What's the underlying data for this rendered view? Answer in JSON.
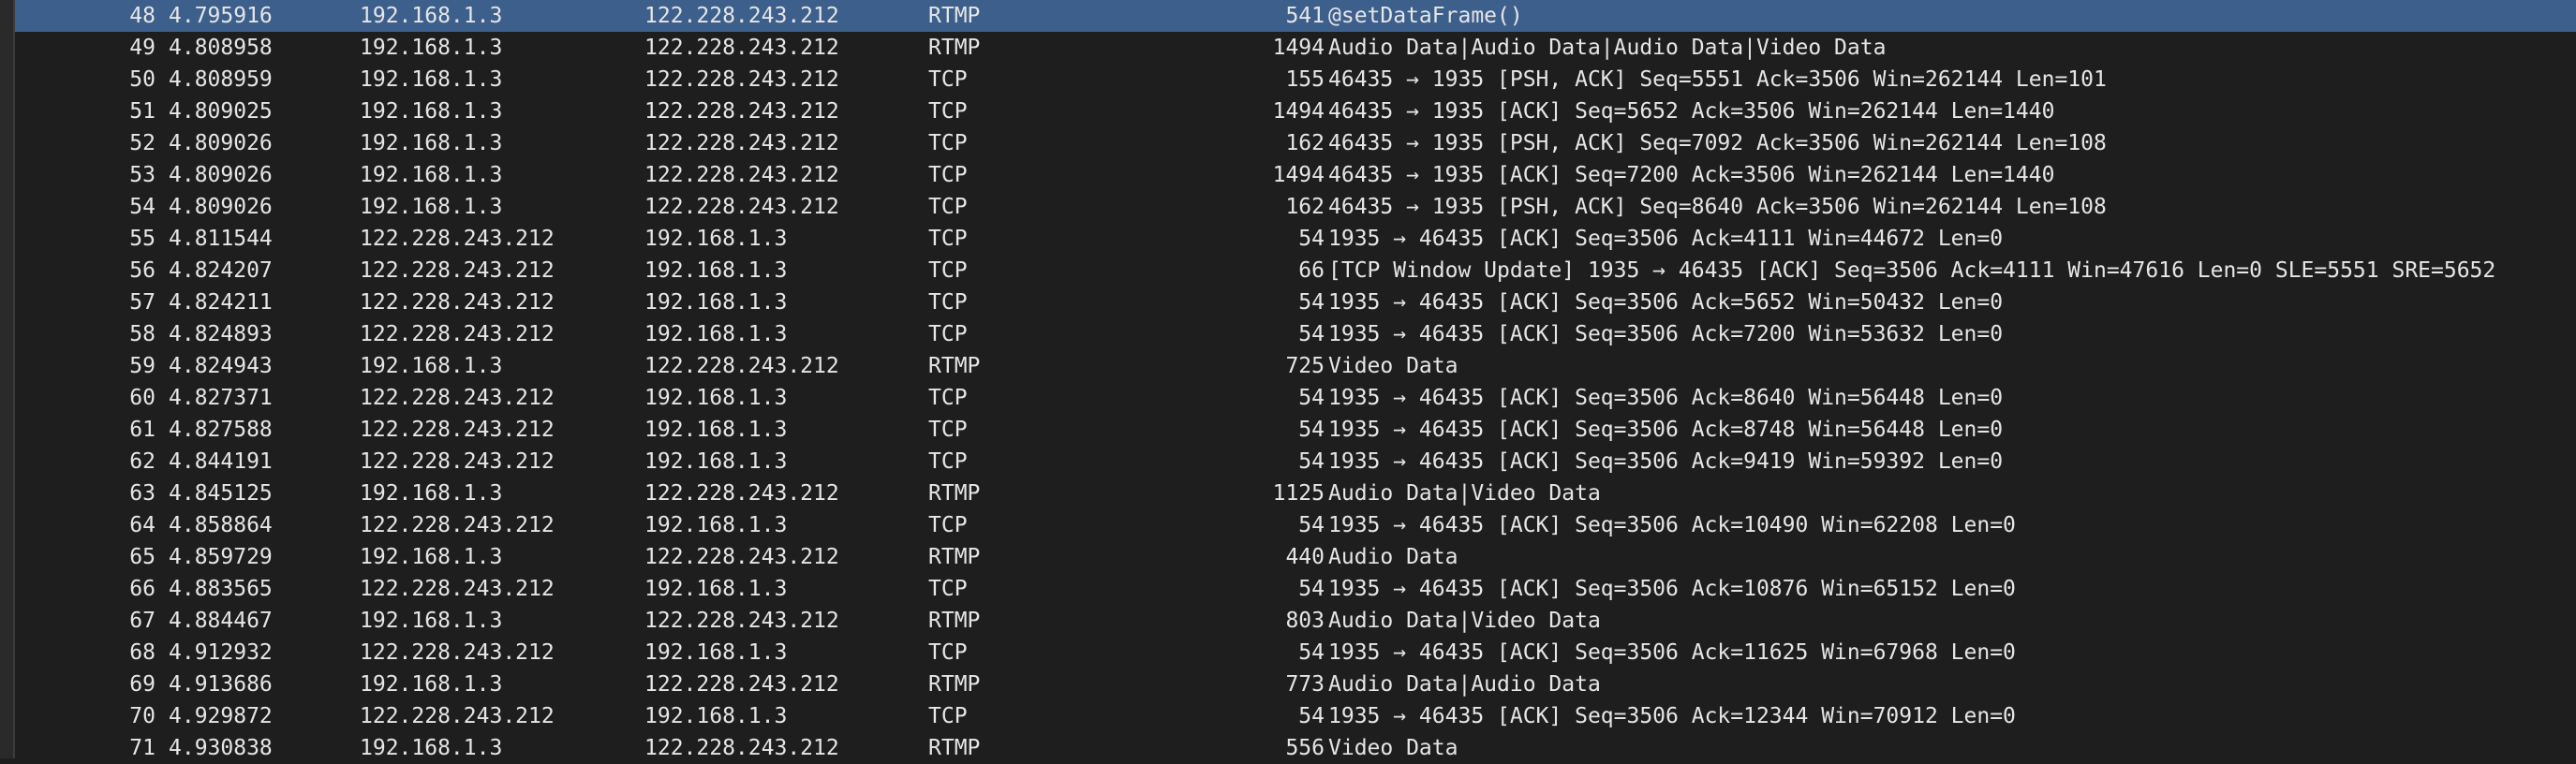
{
  "packets": [
    {
      "no": "48",
      "time": "4.795916",
      "src": "192.168.1.3",
      "dst": "122.228.243.212",
      "proto": "RTMP",
      "len": "541",
      "info": "@setDataFrame()",
      "selected": true
    },
    {
      "no": "49",
      "time": "4.808958",
      "src": "192.168.1.3",
      "dst": "122.228.243.212",
      "proto": "RTMP",
      "len": "1494",
      "info": "Audio Data|Audio Data|Audio Data|Video Data"
    },
    {
      "no": "50",
      "time": "4.808959",
      "src": "192.168.1.3",
      "dst": "122.228.243.212",
      "proto": "TCP",
      "len": "155",
      "info": "46435 → 1935 [PSH, ACK] Seq=5551 Ack=3506 Win=262144 Len=101"
    },
    {
      "no": "51",
      "time": "4.809025",
      "src": "192.168.1.3",
      "dst": "122.228.243.212",
      "proto": "TCP",
      "len": "1494",
      "info": "46435 → 1935 [ACK] Seq=5652 Ack=3506 Win=262144 Len=1440"
    },
    {
      "no": "52",
      "time": "4.809026",
      "src": "192.168.1.3",
      "dst": "122.228.243.212",
      "proto": "TCP",
      "len": "162",
      "info": "46435 → 1935 [PSH, ACK] Seq=7092 Ack=3506 Win=262144 Len=108"
    },
    {
      "no": "53",
      "time": "4.809026",
      "src": "192.168.1.3",
      "dst": "122.228.243.212",
      "proto": "TCP",
      "len": "1494",
      "info": "46435 → 1935 [ACK] Seq=7200 Ack=3506 Win=262144 Len=1440"
    },
    {
      "no": "54",
      "time": "4.809026",
      "src": "192.168.1.3",
      "dst": "122.228.243.212",
      "proto": "TCP",
      "len": "162",
      "info": "46435 → 1935 [PSH, ACK] Seq=8640 Ack=3506 Win=262144 Len=108"
    },
    {
      "no": "55",
      "time": "4.811544",
      "src": "122.228.243.212",
      "dst": "192.168.1.3",
      "proto": "TCP",
      "len": "54",
      "info": "1935 → 46435 [ACK] Seq=3506 Ack=4111 Win=44672 Len=0"
    },
    {
      "no": "56",
      "time": "4.824207",
      "src": "122.228.243.212",
      "dst": "192.168.1.3",
      "proto": "TCP",
      "len": "66",
      "info": "[TCP Window Update] 1935 → 46435 [ACK] Seq=3506 Ack=4111 Win=47616 Len=0 SLE=5551 SRE=5652"
    },
    {
      "no": "57",
      "time": "4.824211",
      "src": "122.228.243.212",
      "dst": "192.168.1.3",
      "proto": "TCP",
      "len": "54",
      "info": "1935 → 46435 [ACK] Seq=3506 Ack=5652 Win=50432 Len=0"
    },
    {
      "no": "58",
      "time": "4.824893",
      "src": "122.228.243.212",
      "dst": "192.168.1.3",
      "proto": "TCP",
      "len": "54",
      "info": "1935 → 46435 [ACK] Seq=3506 Ack=7200 Win=53632 Len=0"
    },
    {
      "no": "59",
      "time": "4.824943",
      "src": "192.168.1.3",
      "dst": "122.228.243.212",
      "proto": "RTMP",
      "len": "725",
      "info": "Video Data"
    },
    {
      "no": "60",
      "time": "4.827371",
      "src": "122.228.243.212",
      "dst": "192.168.1.3",
      "proto": "TCP",
      "len": "54",
      "info": "1935 → 46435 [ACK] Seq=3506 Ack=8640 Win=56448 Len=0"
    },
    {
      "no": "61",
      "time": "4.827588",
      "src": "122.228.243.212",
      "dst": "192.168.1.3",
      "proto": "TCP",
      "len": "54",
      "info": "1935 → 46435 [ACK] Seq=3506 Ack=8748 Win=56448 Len=0"
    },
    {
      "no": "62",
      "time": "4.844191",
      "src": "122.228.243.212",
      "dst": "192.168.1.3",
      "proto": "TCP",
      "len": "54",
      "info": "1935 → 46435 [ACK] Seq=3506 Ack=9419 Win=59392 Len=0"
    },
    {
      "no": "63",
      "time": "4.845125",
      "src": "192.168.1.3",
      "dst": "122.228.243.212",
      "proto": "RTMP",
      "len": "1125",
      "info": "Audio Data|Video Data"
    },
    {
      "no": "64",
      "time": "4.858864",
      "src": "122.228.243.212",
      "dst": "192.168.1.3",
      "proto": "TCP",
      "len": "54",
      "info": "1935 → 46435 [ACK] Seq=3506 Ack=10490 Win=62208 Len=0"
    },
    {
      "no": "65",
      "time": "4.859729",
      "src": "192.168.1.3",
      "dst": "122.228.243.212",
      "proto": "RTMP",
      "len": "440",
      "info": "Audio Data"
    },
    {
      "no": "66",
      "time": "4.883565",
      "src": "122.228.243.212",
      "dst": "192.168.1.3",
      "proto": "TCP",
      "len": "54",
      "info": "1935 → 46435 [ACK] Seq=3506 Ack=10876 Win=65152 Len=0"
    },
    {
      "no": "67",
      "time": "4.884467",
      "src": "192.168.1.3",
      "dst": "122.228.243.212",
      "proto": "RTMP",
      "len": "803",
      "info": "Audio Data|Video Data"
    },
    {
      "no": "68",
      "time": "4.912932",
      "src": "122.228.243.212",
      "dst": "192.168.1.3",
      "proto": "TCP",
      "len": "54",
      "info": "1935 → 46435 [ACK] Seq=3506 Ack=11625 Win=67968 Len=0"
    },
    {
      "no": "69",
      "time": "4.913686",
      "src": "192.168.1.3",
      "dst": "122.228.243.212",
      "proto": "RTMP",
      "len": "773",
      "info": "Audio Data|Audio Data"
    },
    {
      "no": "70",
      "time": "4.929872",
      "src": "122.228.243.212",
      "dst": "192.168.1.3",
      "proto": "TCP",
      "len": "54",
      "info": "1935 → 46435 [ACK] Seq=3506 Ack=12344 Win=70912 Len=0"
    },
    {
      "no": "71",
      "time": "4.930838",
      "src": "192.168.1.3",
      "dst": "122.228.243.212",
      "proto": "RTMP",
      "len": "556",
      "info": "Video Data"
    }
  ],
  "colors": {
    "background": "#1e1e1e",
    "selected_row": "#3d5f8c",
    "text": "#e6e6e6"
  }
}
